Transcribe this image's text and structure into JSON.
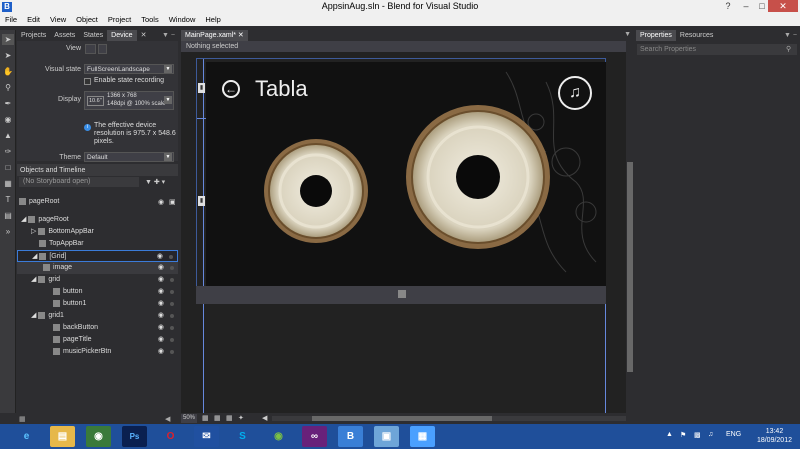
{
  "titlebar": {
    "title": "AppsinAug.sln - Blend for Visual Studio",
    "app_icon": "B"
  },
  "menu": [
    "File",
    "Edit",
    "View",
    "Object",
    "Project",
    "Tools",
    "Window",
    "Help"
  ],
  "left_panel": {
    "tabs": [
      "Projects",
      "Assets",
      "States",
      "Device"
    ],
    "active_tab": "Device",
    "device": {
      "view_label": "View",
      "visual_state_label": "Visual state",
      "visual_state_value": "FullScreenLandscape",
      "state_recording_label": "Enable state recording",
      "display_label": "Display",
      "display_size": "10.6\"",
      "display_resolution": "1366 x 768",
      "display_dpi": "148dpi @ 100% scale",
      "effective_resolution": "The effective device resolution is 975.7 x 548.6 pixels.",
      "theme_label": "Theme",
      "theme_value": "Default"
    },
    "objects_timeline": {
      "header": "Objects and Timeline",
      "storyboard": "(No Storyboard open)",
      "root_label": "pageRoot",
      "tree": [
        {
          "label": "pageRoot",
          "indent": 0,
          "icon": "page-icon"
        },
        {
          "label": "BottomAppBar",
          "indent": 1,
          "icon": "appbar-icon"
        },
        {
          "label": "TopAppBar",
          "indent": 1,
          "icon": "appbar-icon"
        },
        {
          "label": "[Grid]",
          "indent": 1,
          "icon": "grid-icon"
        },
        {
          "label": "image",
          "indent": 2,
          "icon": "image-icon"
        },
        {
          "label": "grid",
          "indent": 1,
          "icon": "grid-icon"
        },
        {
          "label": "button",
          "indent": 2,
          "icon": "button-icon"
        },
        {
          "label": "button1",
          "indent": 2,
          "icon": "button-icon"
        },
        {
          "label": "grid1",
          "indent": 1,
          "icon": "grid-icon"
        },
        {
          "label": "backButton",
          "indent": 2,
          "icon": "button-icon"
        },
        {
          "label": "pageTitle",
          "indent": 2,
          "icon": "textblock-icon"
        },
        {
          "label": "musicPickerBtn",
          "indent": 2,
          "icon": "button-icon"
        }
      ]
    }
  },
  "document": {
    "tab": "MainPage.xaml*",
    "selection": "Nothing selected",
    "zoom": "50%",
    "app": {
      "back_icon": "←",
      "page_title": "Tabla",
      "music_icon": "♫"
    }
  },
  "right_panel": {
    "tabs": [
      "Properties",
      "Resources"
    ],
    "search_placeholder": "Search Properties"
  },
  "taskbar": {
    "apps": [
      "IE",
      "Explorer",
      "Chrome",
      "Ps",
      "Opera",
      "Outlook",
      "Skype",
      "Spotify",
      "VS",
      "Blend",
      "Images",
      "Publisher"
    ],
    "language": "ENG",
    "time": "13:42",
    "date": "18/09/2012"
  },
  "colors": {
    "accent": "#3b7bd9",
    "taskbar": "#1f4f9a",
    "panel": "#2d2d30"
  }
}
